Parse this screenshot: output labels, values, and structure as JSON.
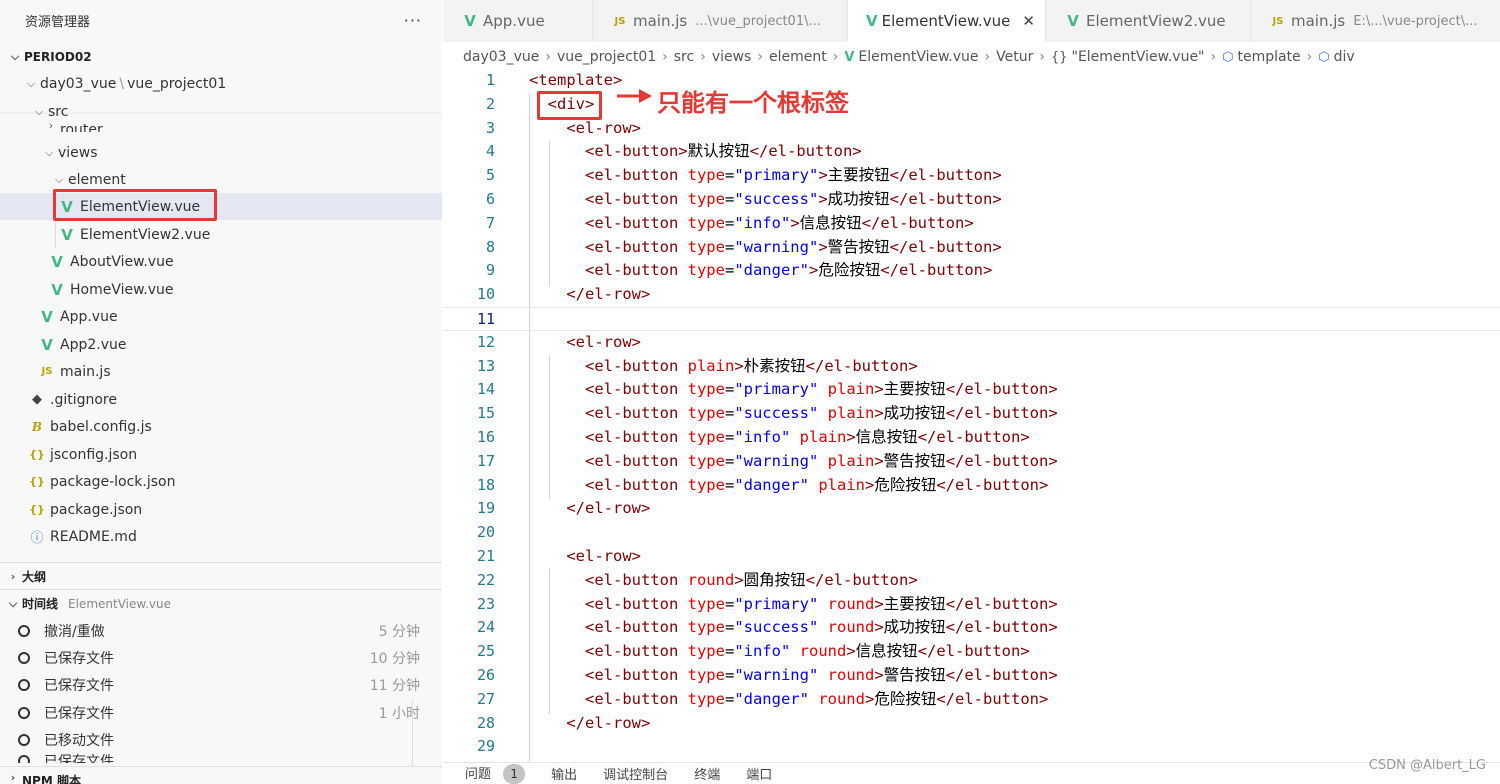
{
  "explorer": {
    "title": "资源管理器",
    "more": "···",
    "root": "PERIOD02",
    "items": [
      {
        "label": "day03_vue",
        "label2": "vue_project01"
      },
      {
        "label": "src"
      },
      {
        "label": "router"
      },
      {
        "label": "views"
      },
      {
        "label": "element"
      },
      {
        "label": "ElementView.vue"
      },
      {
        "label": "ElementView2.vue"
      },
      {
        "label": "AboutView.vue"
      },
      {
        "label": "HomeView.vue"
      },
      {
        "label": "App.vue"
      },
      {
        "label": "App2.vue"
      },
      {
        "label": "main.js"
      },
      {
        "label": ".gitignore"
      },
      {
        "label": "babel.config.js"
      },
      {
        "label": "jsconfig.json"
      },
      {
        "label": "package-lock.json"
      },
      {
        "label": "package.json"
      },
      {
        "label": "README.md"
      }
    ],
    "icons": {
      "vue": "V",
      "js": "JS",
      "json": "{}",
      "babel": "B",
      "git": "◆",
      "info": "ⓘ"
    }
  },
  "outline": {
    "label": "大纲"
  },
  "timeline": {
    "label": "时间线",
    "file": "ElementView.vue",
    "entries": [
      {
        "label": "撤消/重做",
        "time": "5 分钟"
      },
      {
        "label": "已保存文件",
        "time": "10 分钟"
      },
      {
        "label": "已保存文件",
        "time": "11 分钟"
      },
      {
        "label": "已保存文件",
        "time": "1 小时"
      },
      {
        "label": "已移动文件",
        "time": ""
      },
      {
        "label": "已保存文件",
        "time": ""
      }
    ]
  },
  "npm": {
    "label": "NPM 脚本"
  },
  "tabs": [
    {
      "label": "App.vue",
      "desc": "",
      "icon": "vue"
    },
    {
      "label": "main.js",
      "desc": "...\\vue_project01\\...",
      "icon": "js"
    },
    {
      "label": "ElementView.vue",
      "desc": "",
      "icon": "vue",
      "active": true,
      "close": "✕"
    },
    {
      "label": "ElementView2.vue",
      "desc": "",
      "icon": "vue"
    },
    {
      "label": "main.js",
      "desc": "E:\\...\\vue-project\\...",
      "icon": "js"
    }
  ],
  "breadcrumbs": [
    "day03_vue",
    "vue_project01",
    "src",
    "views",
    "element",
    "ElementView.vue",
    "Vetur",
    "\"ElementView.vue\"",
    "template",
    "div"
  ],
  "annotation": "只能有一个根标签",
  "code": [
    {
      "n": "1",
      "tokens": [
        {
          "t": "<template>",
          "c": "tag"
        }
      ]
    },
    {
      "n": "2",
      "tokens": [
        {
          "t": "  <div>",
          "c": "tag"
        }
      ]
    },
    {
      "n": "3",
      "tokens": [
        {
          "t": "    <el-row>",
          "c": "tag"
        }
      ]
    },
    {
      "n": "4",
      "tokens": [
        {
          "t": "      <el-button>",
          "c": "tag"
        },
        {
          "t": "默认按钮",
          "c": "text"
        },
        {
          "t": "</el-button>",
          "c": "tag"
        }
      ]
    },
    {
      "n": "5",
      "tokens": [
        {
          "t": "      <el-button ",
          "c": "tag"
        },
        {
          "t": "type",
          "c": "attr"
        },
        {
          "t": "=",
          "c": "text"
        },
        {
          "t": "\"primary\"",
          "c": "val"
        },
        {
          "t": ">",
          "c": "tag"
        },
        {
          "t": "主要按钮",
          "c": "text"
        },
        {
          "t": "</el-button>",
          "c": "tag"
        }
      ]
    },
    {
      "n": "6",
      "tokens": [
        {
          "t": "      <el-button ",
          "c": "tag"
        },
        {
          "t": "type",
          "c": "attr"
        },
        {
          "t": "=",
          "c": "text"
        },
        {
          "t": "\"success\"",
          "c": "val"
        },
        {
          "t": ">",
          "c": "tag"
        },
        {
          "t": "成功按钮",
          "c": "text"
        },
        {
          "t": "</el-button>",
          "c": "tag"
        }
      ]
    },
    {
      "n": "7",
      "tokens": [
        {
          "t": "      <el-button ",
          "c": "tag"
        },
        {
          "t": "type",
          "c": "attr"
        },
        {
          "t": "=",
          "c": "text"
        },
        {
          "t": "\"info\"",
          "c": "val"
        },
        {
          "t": ">",
          "c": "tag"
        },
        {
          "t": "信息按钮",
          "c": "text"
        },
        {
          "t": "</el-button>",
          "c": "tag"
        }
      ]
    },
    {
      "n": "8",
      "tokens": [
        {
          "t": "      <el-button ",
          "c": "tag"
        },
        {
          "t": "type",
          "c": "attr"
        },
        {
          "t": "=",
          "c": "text"
        },
        {
          "t": "\"warning\"",
          "c": "val"
        },
        {
          "t": ">",
          "c": "tag"
        },
        {
          "t": "警告按钮",
          "c": "text"
        },
        {
          "t": "</el-button>",
          "c": "tag"
        }
      ]
    },
    {
      "n": "9",
      "tokens": [
        {
          "t": "      <el-button ",
          "c": "tag"
        },
        {
          "t": "type",
          "c": "attr"
        },
        {
          "t": "=",
          "c": "text"
        },
        {
          "t": "\"danger\"",
          "c": "val"
        },
        {
          "t": ">",
          "c": "tag"
        },
        {
          "t": "危险按钮",
          "c": "text"
        },
        {
          "t": "</el-button>",
          "c": "tag"
        }
      ]
    },
    {
      "n": "10",
      "tokens": [
        {
          "t": "    </el-row>",
          "c": "tag"
        }
      ]
    },
    {
      "n": "11",
      "tokens": [],
      "current": true
    },
    {
      "n": "12",
      "tokens": [
        {
          "t": "    <el-row>",
          "c": "tag"
        }
      ]
    },
    {
      "n": "13",
      "tokens": [
        {
          "t": "      <el-button ",
          "c": "tag"
        },
        {
          "t": "plain",
          "c": "attr"
        },
        {
          "t": ">",
          "c": "tag"
        },
        {
          "t": "朴素按钮",
          "c": "text"
        },
        {
          "t": "</el-button>",
          "c": "tag"
        }
      ]
    },
    {
      "n": "14",
      "tokens": [
        {
          "t": "      <el-button ",
          "c": "tag"
        },
        {
          "t": "type",
          "c": "attr"
        },
        {
          "t": "=",
          "c": "text"
        },
        {
          "t": "\"primary\"",
          "c": "val"
        },
        {
          "t": " ",
          "c": "text"
        },
        {
          "t": "plain",
          "c": "attr"
        },
        {
          "t": ">",
          "c": "tag"
        },
        {
          "t": "主要按钮",
          "c": "text"
        },
        {
          "t": "</el-button>",
          "c": "tag"
        }
      ]
    },
    {
      "n": "15",
      "tokens": [
        {
          "t": "      <el-button ",
          "c": "tag"
        },
        {
          "t": "type",
          "c": "attr"
        },
        {
          "t": "=",
          "c": "text"
        },
        {
          "t": "\"success\"",
          "c": "val"
        },
        {
          "t": " ",
          "c": "text"
        },
        {
          "t": "plain",
          "c": "attr"
        },
        {
          "t": ">",
          "c": "tag"
        },
        {
          "t": "成功按钮",
          "c": "text"
        },
        {
          "t": "</el-button>",
          "c": "tag"
        }
      ]
    },
    {
      "n": "16",
      "tokens": [
        {
          "t": "      <el-button ",
          "c": "tag"
        },
        {
          "t": "type",
          "c": "attr"
        },
        {
          "t": "=",
          "c": "text"
        },
        {
          "t": "\"info\"",
          "c": "val"
        },
        {
          "t": " ",
          "c": "text"
        },
        {
          "t": "plain",
          "c": "attr"
        },
        {
          "t": ">",
          "c": "tag"
        },
        {
          "t": "信息按钮",
          "c": "text"
        },
        {
          "t": "</el-button>",
          "c": "tag"
        }
      ]
    },
    {
      "n": "17",
      "tokens": [
        {
          "t": "      <el-button ",
          "c": "tag"
        },
        {
          "t": "type",
          "c": "attr"
        },
        {
          "t": "=",
          "c": "text"
        },
        {
          "t": "\"warning\"",
          "c": "val"
        },
        {
          "t": " ",
          "c": "text"
        },
        {
          "t": "plain",
          "c": "attr"
        },
        {
          "t": ">",
          "c": "tag"
        },
        {
          "t": "警告按钮",
          "c": "text"
        },
        {
          "t": "</el-button>",
          "c": "tag"
        }
      ]
    },
    {
      "n": "18",
      "tokens": [
        {
          "t": "      <el-button ",
          "c": "tag"
        },
        {
          "t": "type",
          "c": "attr"
        },
        {
          "t": "=",
          "c": "text"
        },
        {
          "t": "\"danger\"",
          "c": "val"
        },
        {
          "t": " ",
          "c": "text"
        },
        {
          "t": "plain",
          "c": "attr"
        },
        {
          "t": ">",
          "c": "tag"
        },
        {
          "t": "危险按钮",
          "c": "text"
        },
        {
          "t": "</el-button>",
          "c": "tag"
        }
      ]
    },
    {
      "n": "19",
      "tokens": [
        {
          "t": "    </el-row>",
          "c": "tag"
        }
      ]
    },
    {
      "n": "20",
      "tokens": []
    },
    {
      "n": "21",
      "tokens": [
        {
          "t": "    <el-row>",
          "c": "tag"
        }
      ]
    },
    {
      "n": "22",
      "tokens": [
        {
          "t": "      <el-button ",
          "c": "tag"
        },
        {
          "t": "round",
          "c": "attr"
        },
        {
          "t": ">",
          "c": "tag"
        },
        {
          "t": "圆角按钮",
          "c": "text"
        },
        {
          "t": "</el-button>",
          "c": "tag"
        }
      ]
    },
    {
      "n": "23",
      "tokens": [
        {
          "t": "      <el-button ",
          "c": "tag"
        },
        {
          "t": "type",
          "c": "attr"
        },
        {
          "t": "=",
          "c": "text"
        },
        {
          "t": "\"primary\"",
          "c": "val"
        },
        {
          "t": " ",
          "c": "text"
        },
        {
          "t": "round",
          "c": "attr"
        },
        {
          "t": ">",
          "c": "tag"
        },
        {
          "t": "主要按钮",
          "c": "text"
        },
        {
          "t": "</el-button>",
          "c": "tag"
        }
      ]
    },
    {
      "n": "24",
      "tokens": [
        {
          "t": "      <el-button ",
          "c": "tag"
        },
        {
          "t": "type",
          "c": "attr"
        },
        {
          "t": "=",
          "c": "text"
        },
        {
          "t": "\"success\"",
          "c": "val"
        },
        {
          "t": " ",
          "c": "text"
        },
        {
          "t": "round",
          "c": "attr"
        },
        {
          "t": ">",
          "c": "tag"
        },
        {
          "t": "成功按钮",
          "c": "text"
        },
        {
          "t": "</el-button>",
          "c": "tag"
        }
      ]
    },
    {
      "n": "25",
      "tokens": [
        {
          "t": "      <el-button ",
          "c": "tag"
        },
        {
          "t": "type",
          "c": "attr"
        },
        {
          "t": "=",
          "c": "text"
        },
        {
          "t": "\"info\"",
          "c": "val"
        },
        {
          "t": " ",
          "c": "text"
        },
        {
          "t": "round",
          "c": "attr"
        },
        {
          "t": ">",
          "c": "tag"
        },
        {
          "t": "信息按钮",
          "c": "text"
        },
        {
          "t": "</el-button>",
          "c": "tag"
        }
      ]
    },
    {
      "n": "26",
      "tokens": [
        {
          "t": "      <el-button ",
          "c": "tag"
        },
        {
          "t": "type",
          "c": "attr"
        },
        {
          "t": "=",
          "c": "text"
        },
        {
          "t": "\"warning\"",
          "c": "val"
        },
        {
          "t": " ",
          "c": "text"
        },
        {
          "t": "round",
          "c": "attr"
        },
        {
          "t": ">",
          "c": "tag"
        },
        {
          "t": "警告按钮",
          "c": "text"
        },
        {
          "t": "</el-button>",
          "c": "tag"
        }
      ]
    },
    {
      "n": "27",
      "tokens": [
        {
          "t": "      <el-button ",
          "c": "tag"
        },
        {
          "t": "type",
          "c": "attr"
        },
        {
          "t": "=",
          "c": "text"
        },
        {
          "t": "\"danger\"",
          "c": "val"
        },
        {
          "t": " ",
          "c": "text"
        },
        {
          "t": "round",
          "c": "attr"
        },
        {
          "t": ">",
          "c": "tag"
        },
        {
          "t": "危险按钮",
          "c": "text"
        },
        {
          "t": "</el-button>",
          "c": "tag"
        }
      ]
    },
    {
      "n": "28",
      "tokens": [
        {
          "t": "    </el-row>",
          "c": "tag"
        }
      ]
    },
    {
      "n": "29",
      "tokens": []
    }
  ],
  "panel": {
    "problems": "问题",
    "problems_count": "1",
    "output": "输出",
    "debug": "调试控制台",
    "terminal": "终端",
    "ports": "端口"
  },
  "watermark": "CSDN @Albert_LG",
  "colors": {
    "vue": "#41b883",
    "annotation": "#e53935",
    "tag": "#800000",
    "attr": "#e50000",
    "value": "#0000ff"
  }
}
